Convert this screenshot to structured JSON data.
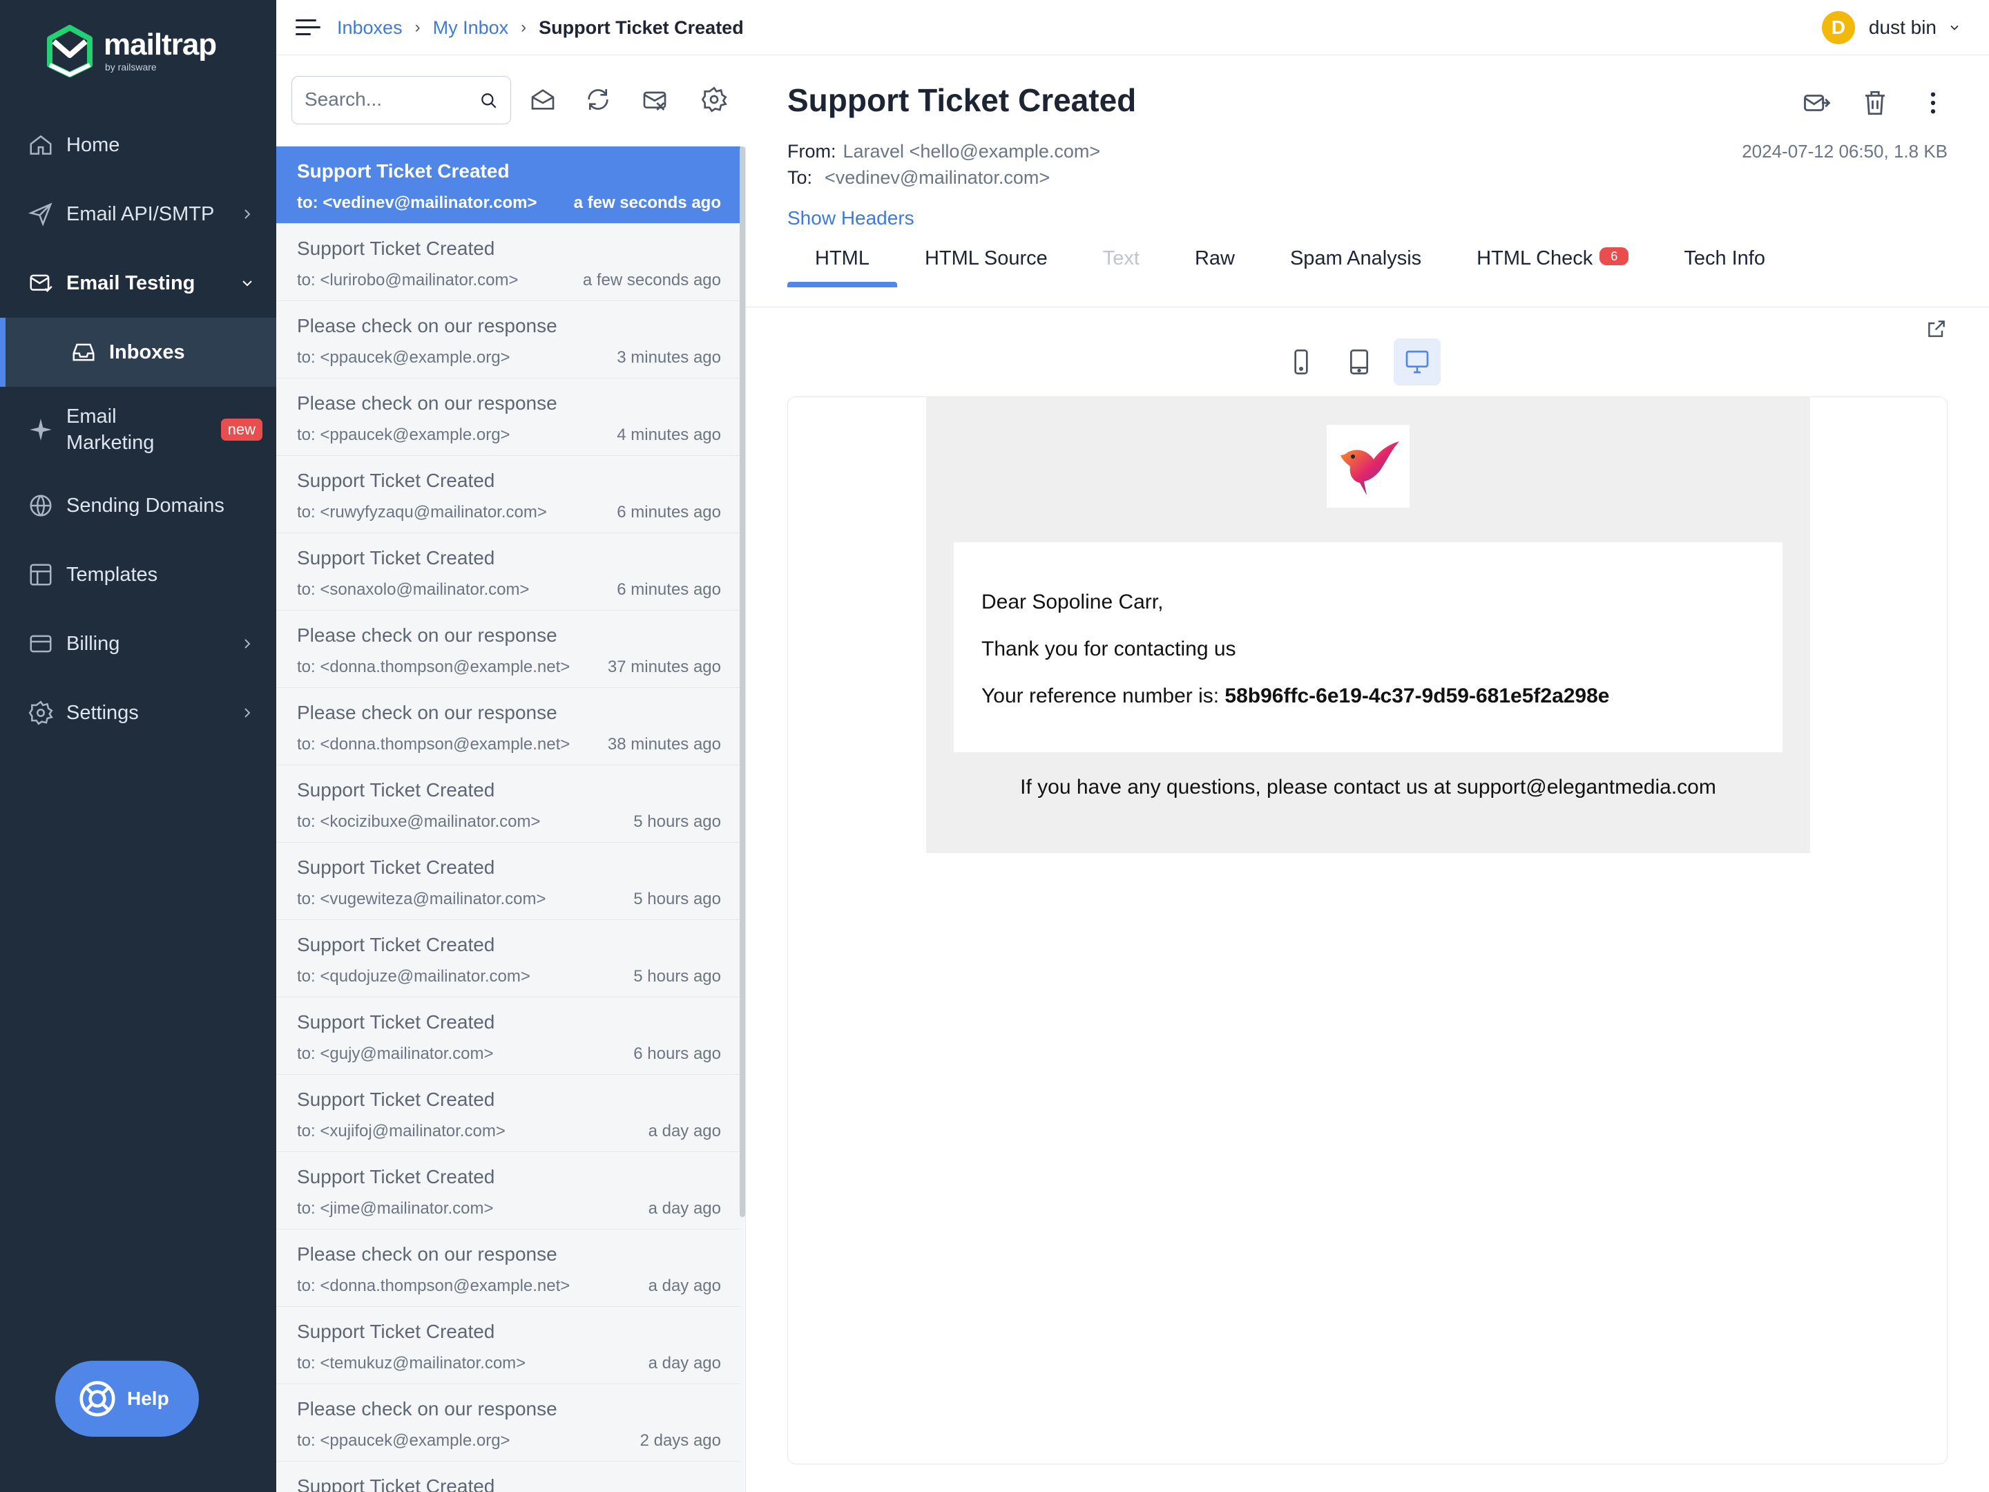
{
  "sidebar": {
    "logo": {
      "name": "mailtrap",
      "sub": "by railsware"
    },
    "items": [
      {
        "label": "Home",
        "icon": "home-icon"
      },
      {
        "label": "Email API/SMTP",
        "icon": "send-icon"
      },
      {
        "label": "Email Testing",
        "icon": "mail-check-icon"
      },
      {
        "label": "Inboxes",
        "icon": "inbox-icon"
      },
      {
        "label": "Email Marketing",
        "icon": "sparkle-icon",
        "badge": "new"
      },
      {
        "label": "Sending Domains",
        "icon": "globe-icon"
      },
      {
        "label": "Templates",
        "icon": "template-icon"
      },
      {
        "label": "Billing",
        "icon": "card-icon"
      },
      {
        "label": "Settings",
        "icon": "gear-icon"
      }
    ],
    "marketing_line1": "Email",
    "marketing_line2": "Marketing",
    "help": "Help"
  },
  "breadcrumb": {
    "items": [
      "Inboxes",
      "My Inbox"
    ],
    "current": "Support Ticket Created"
  },
  "user": {
    "initial": "D",
    "name": "dust bin"
  },
  "search": {
    "placeholder": "Search..."
  },
  "messages": [
    {
      "subject": "Support Ticket Created",
      "to": "to: <vedinev@mailinator.com>",
      "time": "a few seconds ago",
      "active": true
    },
    {
      "subject": "Support Ticket Created",
      "to": "to: <lurirobo@mailinator.com>",
      "time": "a few seconds ago"
    },
    {
      "subject": "Please check on our response",
      "to": "to: <ppaucek@example.org>",
      "time": "3 minutes ago"
    },
    {
      "subject": "Please check on our response",
      "to": "to: <ppaucek@example.org>",
      "time": "4 minutes ago"
    },
    {
      "subject": "Support Ticket Created",
      "to": "to: <ruwyfyzaqu@mailinator.com>",
      "time": "6 minutes ago"
    },
    {
      "subject": "Support Ticket Created",
      "to": "to: <sonaxolo@mailinator.com>",
      "time": "6 minutes ago"
    },
    {
      "subject": "Please check on our response",
      "to": "to: <donna.thompson@example.net>",
      "time": "37 minutes ago"
    },
    {
      "subject": "Please check on our response",
      "to": "to: <donna.thompson@example.net>",
      "time": "38 minutes ago"
    },
    {
      "subject": "Support Ticket Created",
      "to": "to: <kocizibuxe@mailinator.com>",
      "time": "5 hours ago"
    },
    {
      "subject": "Support Ticket Created",
      "to": "to: <vugewiteza@mailinator.com>",
      "time": "5 hours ago"
    },
    {
      "subject": "Support Ticket Created",
      "to": "to: <qudojuze@mailinator.com>",
      "time": "5 hours ago"
    },
    {
      "subject": "Support Ticket Created",
      "to": "to: <gujy@mailinator.com>",
      "time": "6 hours ago"
    },
    {
      "subject": "Support Ticket Created",
      "to": "to: <xujifoj@mailinator.com>",
      "time": "a day ago"
    },
    {
      "subject": "Support Ticket Created",
      "to": "to: <jime@mailinator.com>",
      "time": "a day ago"
    },
    {
      "subject": "Please check on our response",
      "to": "to: <donna.thompson@example.net>",
      "time": "a day ago"
    },
    {
      "subject": "Support Ticket Created",
      "to": "to: <temukuz@mailinator.com>",
      "time": "a day ago"
    },
    {
      "subject": "Please check on our response",
      "to": "to: <ppaucek@example.org>",
      "time": "2 days ago"
    },
    {
      "subject": "Support Ticket Created",
      "to": "",
      "time": ""
    }
  ],
  "detail": {
    "title": "Support Ticket Created",
    "from_label": "From:",
    "from_value": "Laravel <hello@example.com>",
    "to_label": "To:",
    "to_value": "<vedinev@mailinator.com>",
    "date_size": "2024-07-12 06:50, 1.8 KB",
    "show_headers": "Show Headers",
    "tabs": [
      {
        "label": "HTML",
        "state": "active"
      },
      {
        "label": "HTML Source"
      },
      {
        "label": "Text",
        "state": "disabled"
      },
      {
        "label": "Raw"
      },
      {
        "label": "Spam Analysis"
      },
      {
        "label": "HTML Check",
        "count": "6"
      },
      {
        "label": "Tech Info"
      }
    ]
  },
  "email": {
    "greeting": "Dear Sopoline Carr,",
    "thanks": "Thank you for contacting us",
    "ref_label": "Your reference number is: ",
    "ref_value": "58b96ffc-6e19-4c37-9d59-681e5f2a298e",
    "footer": "If you have any questions, please contact us at support@elegantmedia.com"
  },
  "colors": {
    "sidebar": "#1f2d3d",
    "accent": "#4f86e8",
    "badge": "#ea4d4d",
    "avatar": "#f2b90b"
  }
}
